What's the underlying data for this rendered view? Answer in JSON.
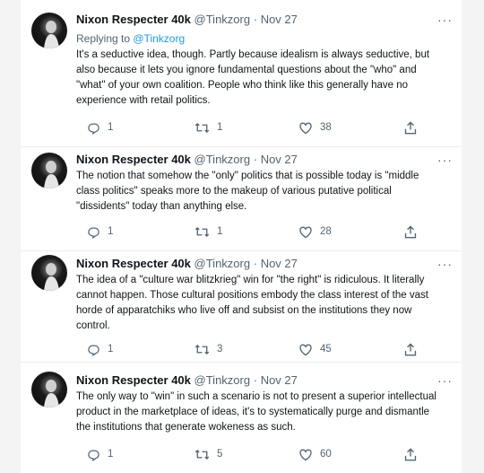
{
  "tweets": [
    {
      "name": "Nixon Respecter 40k",
      "handle": "@Tinkzorg",
      "dot": "·",
      "date": "Nov 27",
      "reply_prefix": "Replying to ",
      "reply_to": "@Tinkzorg",
      "text": "It's a seductive idea, though. Partly because idealism is always seductive, but also because it lets you ignore fundamental questions about the \"who\" and \"what\" of your own coalition. People who think like this generally have no experience with retail politics.",
      "replies": "1",
      "retweets": "1",
      "likes": "38"
    },
    {
      "name": "Nixon Respecter 40k",
      "handle": "@Tinkzorg",
      "dot": "·",
      "date": "Nov 27",
      "text": "The notion that somehow the \"only\" politics that is possible today is \"middle class politics\" speaks more to the makeup of various putative political \"dissidents\" today than anything else.",
      "replies": "1",
      "retweets": "1",
      "likes": "28"
    },
    {
      "name": "Nixon Respecter 40k",
      "handle": "@Tinkzorg",
      "dot": "·",
      "date": "Nov 27",
      "text": "The idea of a \"culture war blitzkrieg\" win for \"the right\" is ridiculous. It literally cannot happen. Those cultural positions embody the class interest of the vast horde of apparatchiks who live off and subsist on the institutions they now control.",
      "replies": "1",
      "retweets": "3",
      "likes": "45"
    },
    {
      "name": "Nixon Respecter 40k",
      "handle": "@Tinkzorg",
      "dot": "·",
      "date": "Nov 27",
      "text": "The only way to \"win\" in such a scenario is not to present a superior intellectual product in the marketplace of ideas, it's to systematically purge and dismantle the institutions that generate wokeness as such.",
      "replies": "1",
      "retweets": "5",
      "likes": "60"
    }
  ],
  "icons": {
    "more": "more-icon",
    "reply": "reply-icon",
    "retweet": "retweet-icon",
    "like": "heart-icon",
    "share": "share-icon"
  },
  "more_glyph": "···"
}
